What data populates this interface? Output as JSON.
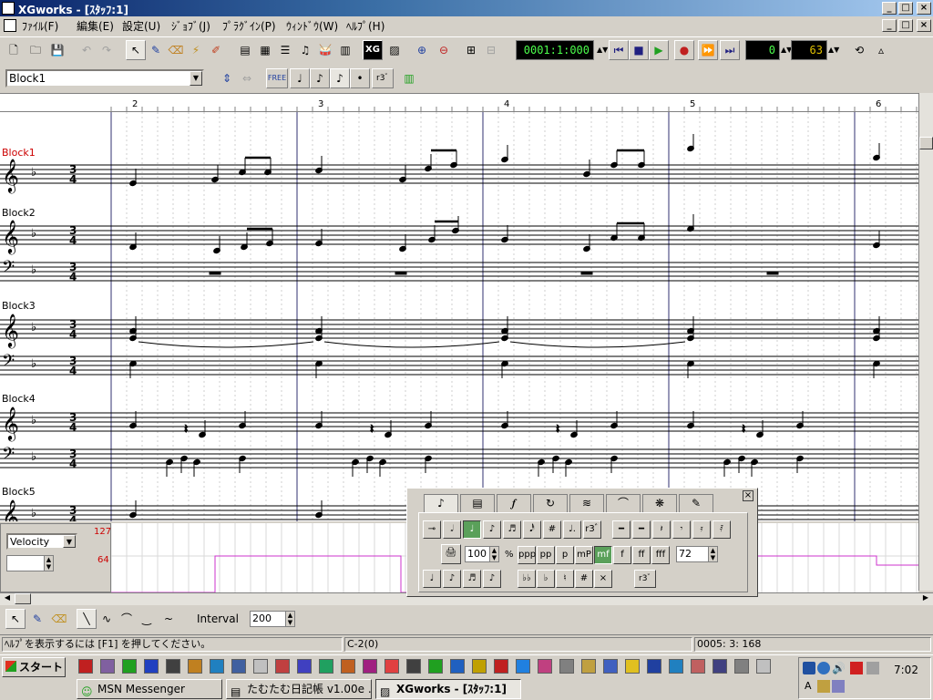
{
  "window": {
    "title": "XGworks - [ｽﾀｯﾌ:1]",
    "min": "_",
    "max": "□",
    "close": "×",
    "doc_min": "_",
    "doc_max": "□",
    "doc_close": "×"
  },
  "menu": [
    "ﾌｧｲﾙ(F)",
    "編集(E)",
    "設定(U)",
    "ｼﾞｮﾌﾞ(J)",
    "ﾌﾟﾗｸﾞｲﾝ(P)",
    "ｳｨﾝﾄﾞｳ(W)",
    "ﾍﾙﾌﾟ(H)"
  ],
  "transport": {
    "position": "0001:1:000",
    "lcd2": "0",
    "lcd3": "63"
  },
  "block_select": {
    "value": "Block1"
  },
  "note_buttons": [
    "FREE",
    "r3ﾞ"
  ],
  "ruler": {
    "bars": [
      "2",
      "3",
      "4",
      "5",
      "6"
    ]
  },
  "blocks": [
    {
      "label": "Block1",
      "color": "#cc0000"
    },
    {
      "label": "Block2",
      "color": "#000000"
    },
    {
      "label": "Block3",
      "color": "#000000"
    },
    {
      "label": "Block4",
      "color": "#000000"
    },
    {
      "label": "Block5",
      "color": "#000000"
    }
  ],
  "time_signature": {
    "top": "3",
    "bottom": "4"
  },
  "key_signature": "♭",
  "velocity_panel": {
    "select": "Velocity",
    "max_label": "127",
    "mid_label": "64",
    "input_value": ""
  },
  "palette": {
    "tabs": [
      "♪",
      "▤",
      "𝆑",
      "↻",
      "≋",
      "⌒",
      "❋",
      "✎"
    ],
    "row1": [
      "𝅗𝅥",
      "♩",
      "♪",
      "♬",
      "𝅘𝅥𝅰",
      "#",
      "♩.",
      "r3ﾞ"
    ],
    "row1_rests": [
      "━",
      "━",
      "𝄽",
      "𝄾",
      "𝄿",
      "𝅀"
    ],
    "dynamics": [
      "ppp",
      "pp",
      "p",
      "mP",
      "mf",
      "f",
      "ff",
      "fff"
    ],
    "active_dynamic": "mf",
    "velocity_value": "100",
    "velocity_unit": "%",
    "gate_value": "72",
    "row3_notes": [
      "♩",
      "♪",
      "♬",
      "♪"
    ],
    "accidentals": [
      "♭♭",
      "♭",
      "♮",
      "#",
      "×"
    ],
    "triplet": "r3ﾞ",
    "close": "×"
  },
  "edit_tools": {
    "interval_label": "Interval",
    "interval_value": "200"
  },
  "status": {
    "help": "ﾍﾙﾌﾟを表示するには [F1] を押してください。",
    "note": "C-2(0)",
    "position": "0005: 3: 168"
  },
  "taskbar": {
    "start": "スタート",
    "tasks": [
      "MSN Messenger",
      "たむたむ日記帳 v1.00e ...",
      "XGworks - [ｽﾀｯﾌ:1]"
    ],
    "active_task": 2,
    "clock": "7:02"
  },
  "colors": {
    "lcd_text": "#4cff4c",
    "velocity_line": "#cc33cc",
    "active_dynamic": "#5aa05a",
    "block1_label": "#cc0000"
  }
}
